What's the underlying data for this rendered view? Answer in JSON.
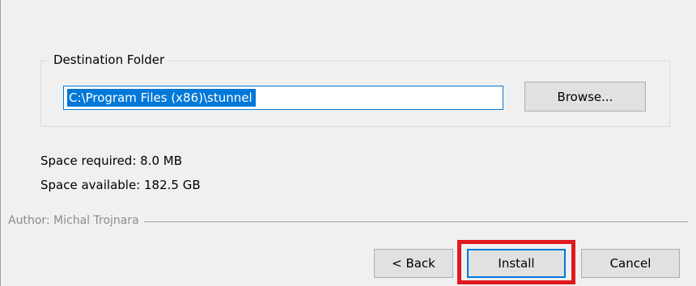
{
  "destination": {
    "group_label": "Destination Folder",
    "path_value": "C:\\Program Files (x86)\\stunnel",
    "browse_label": "Browse..."
  },
  "space": {
    "required": "Space required: 8.0 MB",
    "available": "Space available: 182.5 GB"
  },
  "branding": {
    "author": "Author: Michal Trojnara"
  },
  "buttons": {
    "back_label": "< Back",
    "install_label": "Install",
    "cancel_label": "Cancel"
  },
  "colors": {
    "selection": "#0078d7",
    "highlight": "#e0191f",
    "button_face": "#e1e1e1",
    "background": "#f0f0f0"
  }
}
